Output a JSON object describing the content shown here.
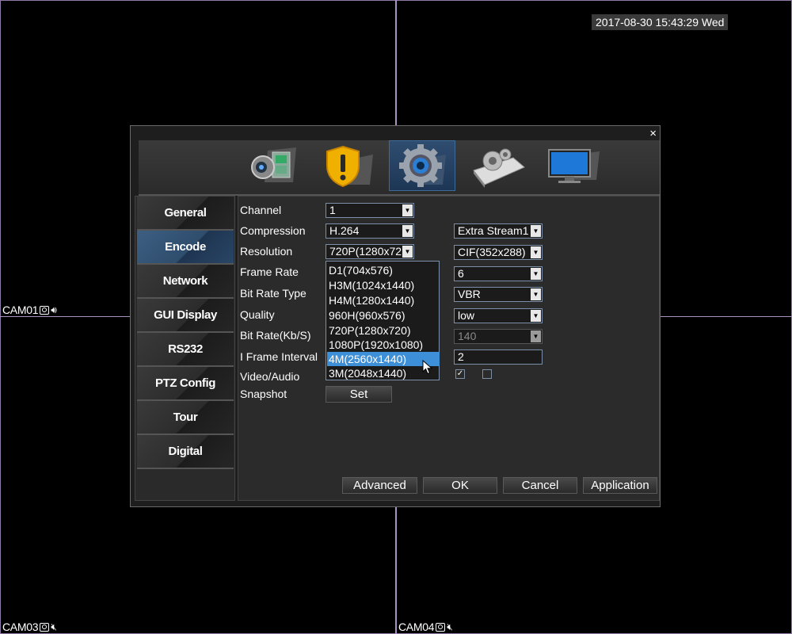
{
  "overlay": {
    "datetime": "2017-08-30 15:43:29 Wed",
    "cameras": [
      {
        "label": "CAM01"
      },
      {
        "label": "CAM03"
      },
      {
        "label": "CAM04"
      }
    ]
  },
  "dialog": {
    "close": "×",
    "top_tabs": [
      "record-icon",
      "alarm-icon",
      "system-settings-icon",
      "tools-icon",
      "info-monitor-icon"
    ],
    "sidebar": {
      "items": [
        {
          "label": "General"
        },
        {
          "label": "Encode"
        },
        {
          "label": "Network"
        },
        {
          "label": "GUI Display"
        },
        {
          "label": "RS232"
        },
        {
          "label": "PTZ Config"
        },
        {
          "label": "Tour"
        },
        {
          "label": "Digital"
        }
      ]
    },
    "form": {
      "labels": {
        "channel": "Channel",
        "compression": "Compression",
        "resolution": "Resolution",
        "frame_rate": "Frame Rate",
        "bit_rate_type": "Bit Rate Type",
        "quality": "Quality",
        "bit_rate": "Bit Rate(Kb/S)",
        "iframe": "I Frame Interval",
        "video_audio": "Video/Audio",
        "snapshot": "Snapshot"
      },
      "main": {
        "channel": "1",
        "compression": "H.264",
        "resolution": "720P(1280x72"
      },
      "extra": {
        "stream": "Extra Stream1",
        "resolution": "CIF(352x288)",
        "frame_rate": "6",
        "bit_rate_type": "VBR",
        "quality": "low",
        "bit_rate": "140",
        "iframe": "2",
        "video_checked": "✓",
        "audio_checked": ""
      },
      "snapshot_button": "Set",
      "resolution_options": [
        "D1(704x576)",
        "H3M(1024x1440)",
        "H4M(1280x1440)",
        "960H(960x576)",
        "720P(1280x720)",
        "1080P(1920x1080)",
        "4M(2560x1440)",
        "3M(2048x1440)"
      ],
      "resolution_highlighted": "4M(2560x1440)"
    },
    "buttons": {
      "advanced": "Advanced",
      "ok": "OK",
      "cancel": "Cancel",
      "application": "Application"
    }
  }
}
